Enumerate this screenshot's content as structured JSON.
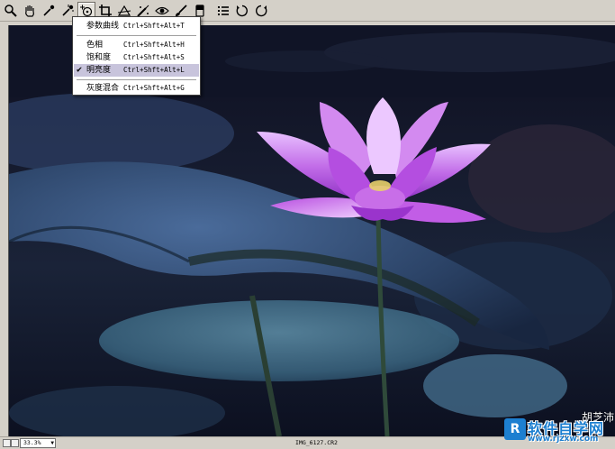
{
  "toolbar": {
    "tools": [
      {
        "icon": "zoom-icon"
      },
      {
        "icon": "hand-icon"
      },
      {
        "icon": "eyedropper-icon"
      },
      {
        "icon": "color-sampler-icon"
      },
      {
        "icon": "target-adjustment-icon",
        "active": true
      },
      {
        "icon": "crop-icon"
      },
      {
        "icon": "straighten-icon"
      },
      {
        "icon": "spot-removal-icon"
      },
      {
        "icon": "red-eye-icon"
      },
      {
        "icon": "adjustment-brush-icon"
      },
      {
        "icon": "graduated-filter-icon"
      },
      {
        "icon": "preferences-icon"
      },
      {
        "icon": "rotate-left-icon"
      },
      {
        "icon": "rotate-right-icon"
      }
    ]
  },
  "menu": {
    "items": [
      {
        "label": "参数曲线",
        "shortcut": "Ctrl+Shft+Alt+T",
        "checked": false
      },
      {
        "label": "色相",
        "shortcut": "Ctrl+Shft+Alt+H",
        "checked": false
      },
      {
        "label": "饱和度",
        "shortcut": "Ctrl+Shft+Alt+S",
        "checked": false
      },
      {
        "label": "明亮度",
        "shortcut": "Ctrl+Shft+Alt+L",
        "checked": true
      },
      {
        "label": "灰度混合",
        "shortcut": "Ctrl+Shft+Alt+G",
        "checked": false
      }
    ],
    "check_mark": "✔"
  },
  "statusbar": {
    "zoom": "33.3%",
    "zoom_arrow": "▼",
    "filename": "IMG_6127.CR2"
  },
  "watermark": {
    "author": "胡芝沛",
    "logo_letter": "R",
    "site_name": "软件自学网",
    "site_url": "www.rjzxw.com"
  },
  "colors": {
    "toolbar_bg": "#d4d0c8",
    "menu_selected": "#c8c4dc",
    "petal": "#b34ee0",
    "logo_blue": "#1d7fd0"
  }
}
